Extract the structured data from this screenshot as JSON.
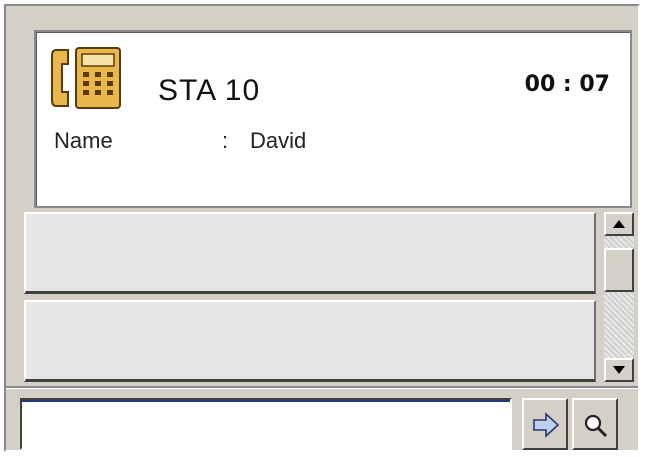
{
  "call": {
    "station": "STA 10",
    "timer": "00 : 07",
    "name_label": "Name",
    "name_separator": ":",
    "name_value": "David"
  },
  "icons": {
    "phone": "telephone-handset-icon",
    "go": "arrow-right-icon",
    "search": "magnifier-icon",
    "scroll_up": "arrow-up-icon",
    "scroll_down": "arrow-down-icon"
  },
  "dial_input": {
    "value": "",
    "placeholder": ""
  },
  "colors": {
    "panel_bg": "#d4d0c8",
    "phone_icon": "#e8b84a",
    "go_arrow": "#bcd0f0"
  }
}
